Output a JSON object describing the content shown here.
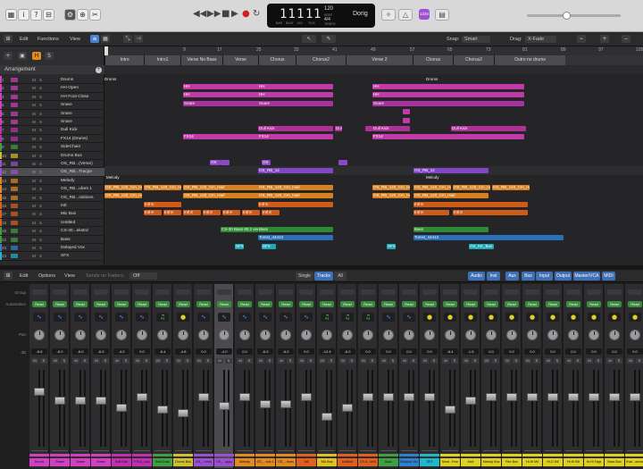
{
  "toolbar": {
    "title_icons": [
      "library-icon",
      "info-icon",
      "quick-help-icon",
      "inspector-icon",
      "settings-icon",
      "smart-controls-icon",
      "mixer-icon",
      "editors-icon",
      "scissors-icon"
    ]
  },
  "transport": {
    "buttons": [
      "rewind",
      "fast-forward",
      "stop",
      "play",
      "record",
      "cycle"
    ],
    "lcd": {
      "bar": "11",
      "beat": "1",
      "div": "1",
      "tick": "1",
      "bar_label": "BAR",
      "beat_label": "BEAT",
      "div_label": "DIV",
      "tick_label": "TICK",
      "tempo": "120",
      "tempo_label": "KEEP",
      "tempo_sub": "TEMPO",
      "sig": "4/4",
      "key": "Cmaj",
      "key_label": "Dorig"
    },
    "count_in": "1234",
    "badge": "1234"
  },
  "arrange_bar": {
    "edit": "Edit",
    "functions": "Functions",
    "view": "View",
    "snap_label": "Snap:",
    "snap_value": "Smart",
    "drag_label": "Drag:",
    "drag_value": "X-Fade"
  },
  "ruler": [
    {
      "label": "1"
    },
    {
      "label": "9"
    },
    {
      "label": "17"
    },
    {
      "label": "25"
    },
    {
      "label": "33"
    },
    {
      "label": "41"
    },
    {
      "label": "49"
    },
    {
      "label": "57"
    },
    {
      "label": "65"
    },
    {
      "label": "73"
    },
    {
      "label": "81"
    },
    {
      "label": "89"
    },
    {
      "label": "97"
    },
    {
      "label": "105"
    }
  ],
  "arrangement_header": "Arrangement",
  "markers": [
    {
      "label": "Intro"
    },
    {
      "label": "Intro1"
    },
    {
      "label": "Verse No Bass"
    },
    {
      "label": "Verse"
    },
    {
      "label": "Chorus"
    },
    {
      "label": "Chorus2"
    },
    {
      "label": "Verse 2"
    },
    {
      "label": "Chorus"
    },
    {
      "label": "Chorus2"
    },
    {
      "label": "Outro no drums"
    }
  ],
  "tracks": [
    {
      "num": "1",
      "name": "Drums",
      "color": "#d040c0"
    },
    {
      "num": "2",
      "name": "HH Open",
      "color": "#d040c0"
    },
    {
      "num": "3",
      "name": "HH Foot Close",
      "color": "#d040c0"
    },
    {
      "num": "4",
      "name": "Snare",
      "color": "#d040c0"
    },
    {
      "num": "5",
      "name": "Snare",
      "color": "#d040c0"
    },
    {
      "num": "6",
      "name": "Snare",
      "color": "#d040c0"
    },
    {
      "num": "7",
      "name": "Dull Kick",
      "color": "#c030b0"
    },
    {
      "num": "8",
      "name": "FX14 (Drums)",
      "color": "#c030b0"
    },
    {
      "num": "9",
      "name": "SideChain",
      "color": "#40a040"
    },
    {
      "num": "10",
      "name": "Drums Bus",
      "color": "#d0c030"
    },
    {
      "num": "11",
      "name": "OS_RB...(Verse)",
      "color": "#9a50d0"
    },
    {
      "num": "12",
      "name": "OS_RB...Tracpe",
      "color": "#9a50d0"
    },
    {
      "num": "13",
      "name": "Melody",
      "color": "#e08a20"
    },
    {
      "num": "14",
      "name": "OS_RB...ufars 1",
      "color": "#e08a20"
    },
    {
      "num": "15",
      "name": "OS_RB...ositions",
      "color": "#e08a20"
    },
    {
      "num": "16",
      "name": "Intl",
      "color": "#e06020"
    },
    {
      "num": "17",
      "name": "Mix Bus",
      "color": "#e06020"
    },
    {
      "num": "18",
      "name": "Untitled",
      "color": "#e06020"
    },
    {
      "num": "19",
      "name": "CS-30...ekstrd",
      "color": "#40a040"
    },
    {
      "num": "22",
      "name": "Bass",
      "color": "#40a040"
    },
    {
      "num": "23",
      "name": "Delayed Vox",
      "color": "#3080d0"
    },
    {
      "num": "24",
      "name": "SFX",
      "color": "#20b8c8"
    }
  ],
  "regions": {
    "drums_label": "Drums",
    "hh": "HH",
    "snare": "Snare",
    "dull_kick": "Dull Kick",
    "fx14": "FX14",
    "os": "OS",
    "os_rb": "OS_RB_12",
    "melody": "Melody",
    "os_long": "OS_RB_120_Cm_Harl",
    "intl": "Intl 8",
    "intl_b": "Intl 8",
    "cs30": "CS-30 Bass 80.2 ver",
    "bass": "Bass",
    "vox": "Tomst_44413",
    "sfx": "SFX",
    "os_kk": "OS_KK_Bus",
    "dull": "Dull"
  },
  "mixer_bar": {
    "edit": "Edit",
    "options": "Options",
    "view": "View",
    "sends": "Sends on Faders:",
    "off": "Off",
    "single": "Single",
    "tracks": "Tracks",
    "all": "All",
    "filters": [
      "Audio",
      "Inst",
      "Aux",
      "Bus",
      "Input",
      "Output",
      "Master/VCA",
      "MIDI"
    ]
  },
  "row_labels": {
    "group": "Group",
    "automation": "Automation",
    "pan": "Pan",
    "db": "dB"
  },
  "strips": [
    {
      "name": "Drums",
      "color": "#d040c0",
      "db": "-6.6",
      "auto": "Read",
      "icon": "wave",
      "sel": false
    },
    {
      "name": "Snare",
      "color": "#d040c0",
      "db": "-6.0",
      "auto": "Read",
      "icon": "wave",
      "sel": false
    },
    {
      "name": "Snare",
      "color": "#d040c0",
      "db": "-6.0",
      "auto": "Read",
      "icon": "wave",
      "sel": false
    },
    {
      "name": "Snare",
      "color": "#d040c0",
      "db": "-6.0",
      "auto": "Read",
      "icon": "wave",
      "sel": false
    },
    {
      "name": "Dull Kick",
      "color": "#c030b0",
      "db": "-4.0",
      "auto": "Read",
      "icon": "wave",
      "sel": false
    },
    {
      "name": "FX14_ums",
      "color": "#c030b0",
      "db": "0.0",
      "auto": "Read",
      "icon": "wave",
      "sel": false
    },
    {
      "name": "SideChain",
      "color": "#40a040",
      "db": "-6.4",
      "auto": "Read",
      "icon": "note",
      "sel": false
    },
    {
      "name": "Drums Bus",
      "color": "#d0c030",
      "db": "-4.8",
      "auto": "Read",
      "icon": "circle",
      "sel": false
    },
    {
      "name": "OS_...erse)",
      "color": "#9a50d0",
      "db": "0.0",
      "auto": "Read",
      "icon": "wave",
      "sel": false
    },
    {
      "name": "OS_...appy",
      "color": "#9a50d0",
      "db": "-4.0",
      "auto": "Read",
      "icon": "wave",
      "sel": true
    },
    {
      "name": "Melody",
      "color": "#e08a20",
      "db": "0.0",
      "auto": "Read",
      "icon": "wave",
      "sel": false
    },
    {
      "name": "OS_...ons 1",
      "color": "#e08a20",
      "db": "-6.0",
      "auto": "Read",
      "icon": "wave",
      "sel": false
    },
    {
      "name": "OS_...tions",
      "color": "#e08a20",
      "db": "-6.0",
      "auto": "Read",
      "icon": "wave",
      "sel": false
    },
    {
      "name": "Intl",
      "color": "#e06020",
      "db": "0.0",
      "auto": "Read",
      "icon": "wave",
      "sel": false
    },
    {
      "name": "Mix Bus",
      "color": "#e0c020",
      "db": "-12.6",
      "auto": "Read",
      "icon": "note",
      "sel": false
    },
    {
      "name": "Untitled",
      "color": "#e06020",
      "db": "-6.0",
      "auto": "Read",
      "icon": "note",
      "sel": false
    },
    {
      "name": "CS-3...ver3",
      "color": "#e06020",
      "db": "0.0",
      "auto": "Read",
      "icon": "note",
      "sel": false
    },
    {
      "name": "Bass",
      "color": "#40a040",
      "db": "0.0",
      "auto": "Read",
      "icon": "wave",
      "sel": false
    },
    {
      "name": "Delayed Vox",
      "color": "#3080d0",
      "db": "0.0",
      "auto": "Read",
      "icon": "wave",
      "sel": false
    },
    {
      "name": "SFX",
      "color": "#20b8c8",
      "db": "0.0",
      "auto": "Read",
      "icon": "circle",
      "sel": false
    },
    {
      "name": "Smal...Fron",
      "color": "#e0d020",
      "db": "-6.4",
      "auto": "Read",
      "icon": "circle",
      "sel": false
    },
    {
      "name": "Kick",
      "color": "#e0d020",
      "db": "-1.5",
      "auto": "Read",
      "icon": "circle",
      "sel": false
    },
    {
      "name": "Melody Bus",
      "color": "#e0d020",
      "db": "0.0",
      "auto": "Read",
      "icon": "circle",
      "sel": false
    },
    {
      "name": "Rev Bus",
      "color": "#e0d020",
      "db": "0.0",
      "auto": "Read",
      "icon": "circle",
      "sel": false
    },
    {
      "name": "Hi-Hi Mit",
      "color": "#e0d020",
      "db": "0.0",
      "auto": "Read",
      "icon": "circle",
      "sel": false
    },
    {
      "name": "Hi-D 5/6",
      "color": "#e0d020",
      "db": "0.0",
      "auto": "Read",
      "icon": "circle",
      "sel": false
    },
    {
      "name": "Hi-Hi 5/6",
      "color": "#e0d020",
      "db": "0.0",
      "auto": "Read",
      "icon": "circle",
      "sel": false
    },
    {
      "name": "Hi-Hi Tags",
      "color": "#e0d020",
      "db": "0.0",
      "auto": "Read",
      "icon": "circle",
      "sel": false
    },
    {
      "name": "Bass Bus",
      "color": "#e0d020",
      "db": "0.0",
      "auto": "Read",
      "icon": "circle",
      "sel": false
    },
    {
      "name": "Eval...amule",
      "color": "#e0d020",
      "db": "0.0",
      "auto": "Read",
      "icon": "circle",
      "sel": false
    }
  ]
}
